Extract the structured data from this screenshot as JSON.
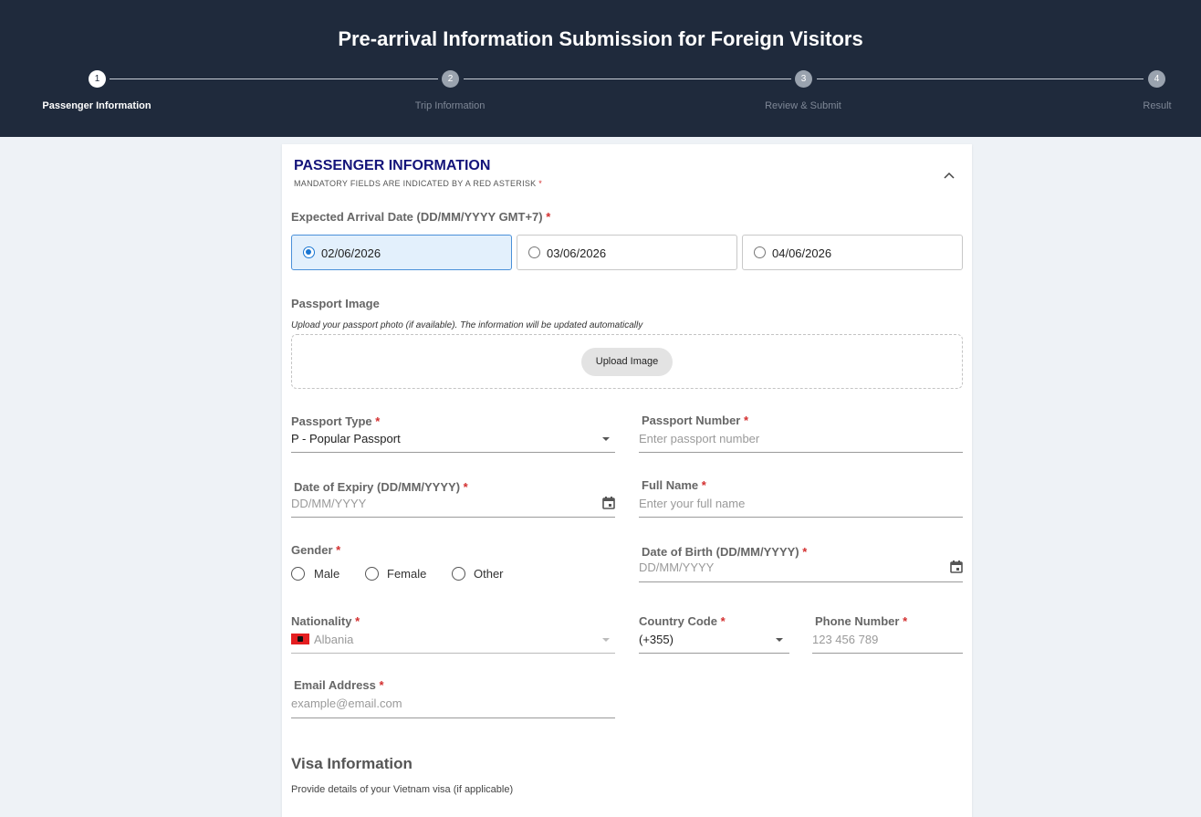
{
  "header": {
    "title": "Pre-arrival Information Submission for Foreign Visitors",
    "steps": [
      {
        "number": "1",
        "label": "Passenger Information"
      },
      {
        "number": "2",
        "label": "Trip Information"
      },
      {
        "number": "3",
        "label": "Review & Submit"
      },
      {
        "number": "4",
        "label": "Result"
      }
    ],
    "current_step": 1
  },
  "section": {
    "title": "PASSENGER INFORMATION",
    "subtitle": "MANDATORY FIELDS ARE INDICATED BY A RED ASTERISK",
    "required_mark": "*"
  },
  "arrival": {
    "label": "Expected Arrival Date (DD/MM/YYYY GMT+7)",
    "options": [
      "02/06/2026",
      "03/06/2026",
      "04/06/2026"
    ],
    "selected": "02/06/2026"
  },
  "passport_image": {
    "label": "Passport Image",
    "help": "Upload your passport photo (if available). The information will be updated automatically",
    "button": "Upload Image"
  },
  "passport_type": {
    "label": "Passport Type",
    "value": "P - Popular Passport"
  },
  "passport_number": {
    "label": "Passport Number",
    "placeholder": "Enter passport number"
  },
  "expiry": {
    "label": "Date of Expiry (DD/MM/YYYY)",
    "placeholder": "DD/MM/YYYY"
  },
  "full_name": {
    "label": "Full Name",
    "placeholder": "Enter your full name"
  },
  "gender": {
    "label": "Gender",
    "options": [
      "Male",
      "Female",
      "Other"
    ]
  },
  "dob": {
    "label": "Date of Birth (DD/MM/YYYY)",
    "placeholder": "DD/MM/YYYY"
  },
  "nationality": {
    "label": "Nationality",
    "value": "Albania",
    "flag_icon": "albania-flag-icon"
  },
  "country_code": {
    "label": "Country Code",
    "value": "(+355)"
  },
  "phone": {
    "label": "Phone Number",
    "placeholder": "123 456 789"
  },
  "email": {
    "label": "Email Address",
    "placeholder": "example@email.com"
  },
  "visa": {
    "title": "Visa Information",
    "subtitle": "Provide details of your Vietnam visa (if applicable)"
  },
  "colors": {
    "header_bg": "#1f2a3c",
    "section_title": "#14147a",
    "required": "#d32f2f",
    "selected_radio": "#1976d2"
  }
}
